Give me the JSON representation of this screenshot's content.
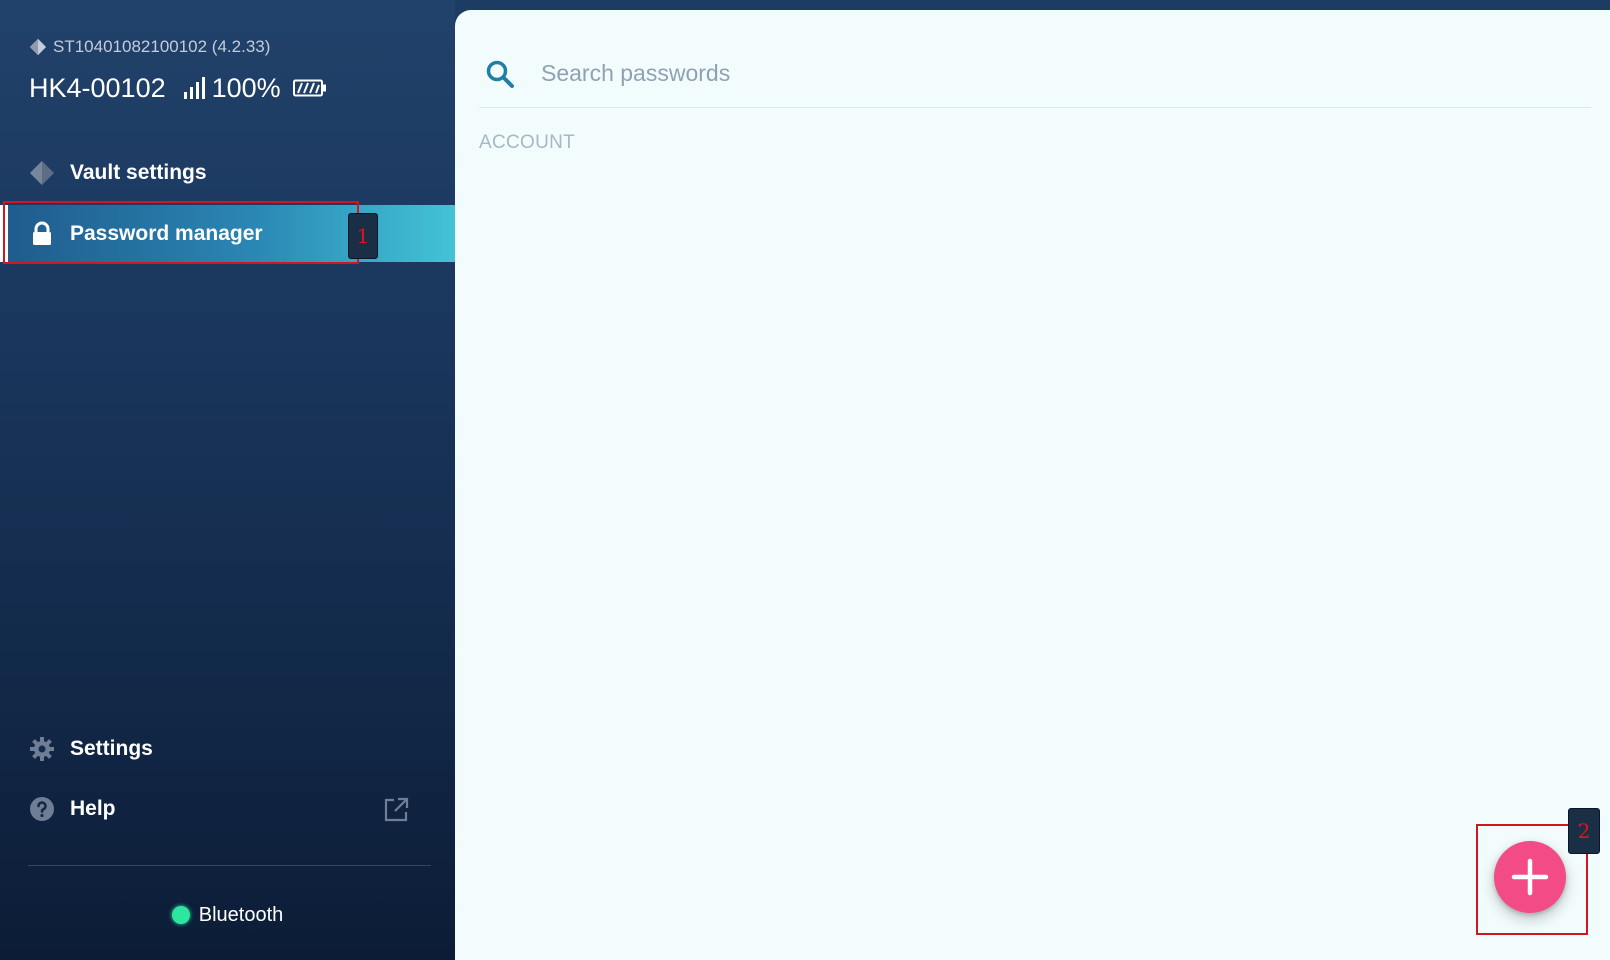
{
  "device": {
    "serial": "ST10401082100102 (4.2.33)",
    "name": "HK4-00102",
    "battery_percent": "100%"
  },
  "nav": {
    "vault_settings": "Vault settings",
    "password_manager": "Password manager",
    "settings": "Settings",
    "help": "Help"
  },
  "connection": {
    "label": "Bluetooth",
    "status_color": "#2ee6a0"
  },
  "search": {
    "placeholder": "Search passwords",
    "value": ""
  },
  "list": {
    "section_header": "ACCOUNT"
  },
  "annotations": {
    "tag_1": "1",
    "tag_2": "2"
  },
  "colors": {
    "accent": "#43c3d6",
    "fab": "#f24b85",
    "sidebar": "#1a365c"
  }
}
